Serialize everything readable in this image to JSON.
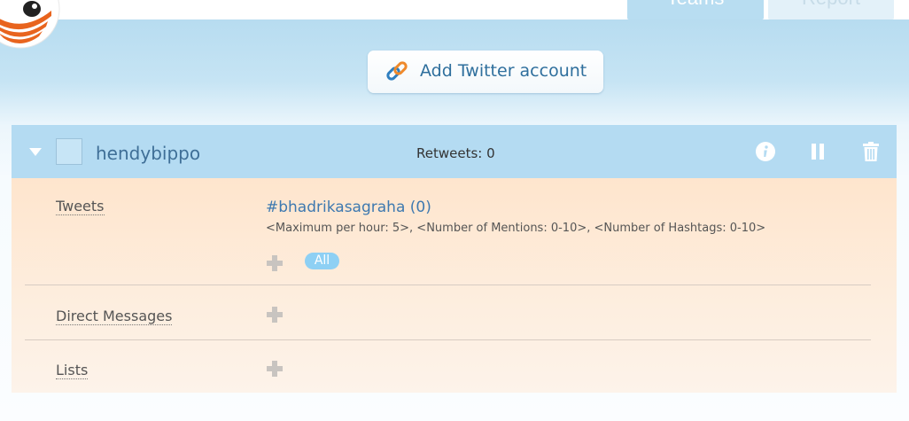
{
  "tabs": [
    {
      "label": "Teams"
    },
    {
      "label": "Report"
    }
  ],
  "add_account": {
    "label": "Add Twitter account"
  },
  "account": {
    "name": "hendybippo",
    "retweets": "Retweets: 0"
  },
  "rows": {
    "tweets": {
      "label": "Tweets",
      "hashtag": "#bhadrikasagraha (0)",
      "limits": "<Maximum per hour: 5>, <Number of Mentions: 0-10>, <Number of Hashtags: 0-10>"
    },
    "direct_messages": {
      "label": "Direct Messages",
      "badge": "All"
    },
    "lists": {
      "label": "Lists"
    }
  },
  "colors": {
    "header": "#b4dbf2",
    "body": "#fee5cd",
    "link": "#3e79b0",
    "badge": "#8ed0f4"
  }
}
